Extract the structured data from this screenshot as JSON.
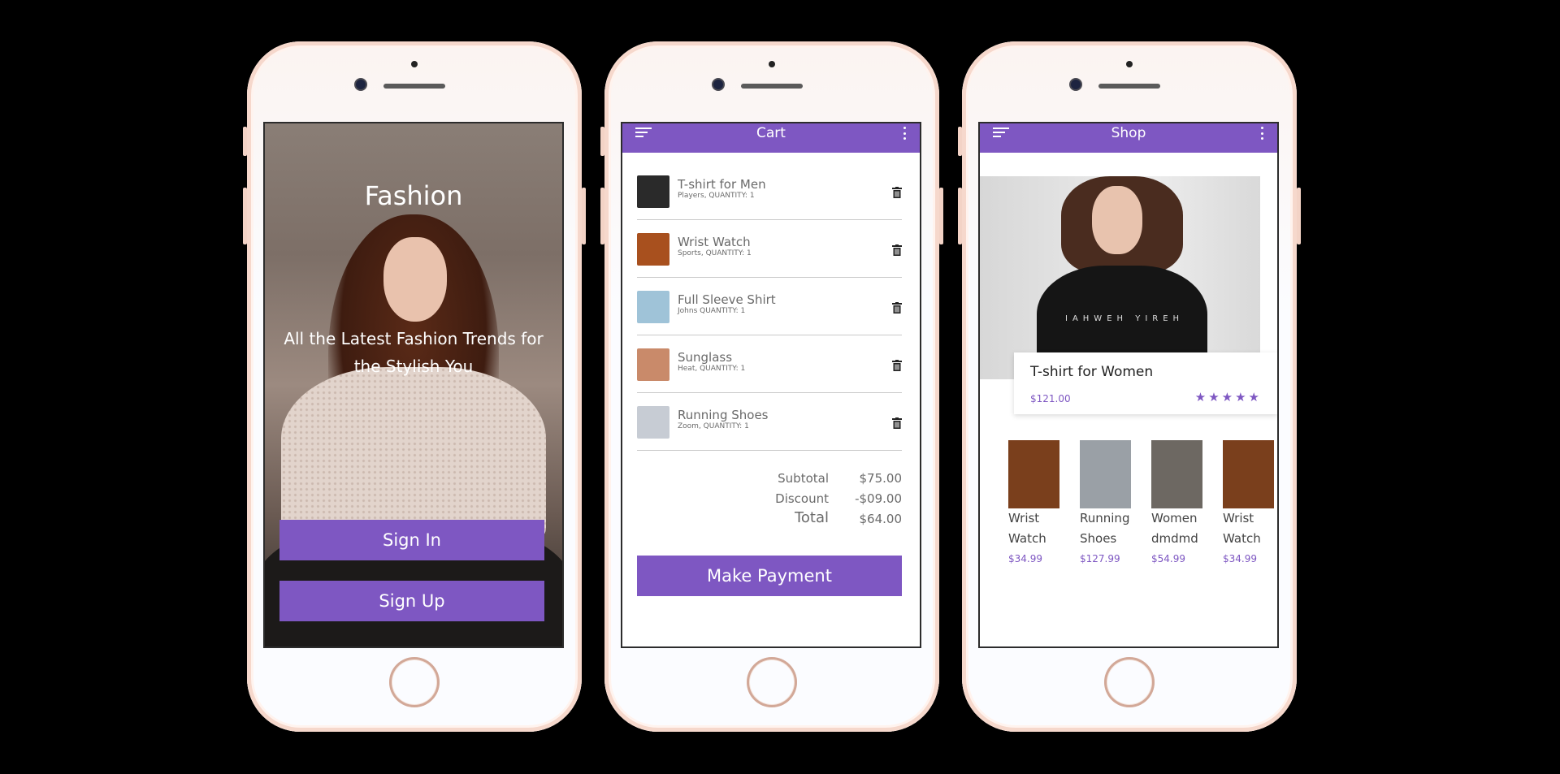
{
  "welcome": {
    "title": "Fashion",
    "subtitle": "All the Latest Fashion Trends for the Stylish You",
    "sign_in": "Sign In",
    "sign_up": "Sign Up"
  },
  "cart": {
    "title": "Cart",
    "items": [
      {
        "name": "T-shirt for Men",
        "meta": "Players, QUANTITY: 1",
        "thumb_color": "#2a2a2a"
      },
      {
        "name": "Wrist Watch",
        "meta": "Sports, QUANTITY: 1",
        "thumb_color": "#a8501e"
      },
      {
        "name": "Full Sleeve Shirt",
        "meta": "Johns QUANTITY: 1",
        "thumb_color": "#9fc3d8"
      },
      {
        "name": "Sunglass",
        "meta": "Heat, QUANTITY: 1",
        "thumb_color": "#c98a6a"
      },
      {
        "name": "Running Shoes",
        "meta": "Zoom, QUANTITY: 1",
        "thumb_color": "#c7ccd4"
      }
    ],
    "subtotal_label": "Subtotal",
    "subtotal_value": "$75.00",
    "discount_label": "Discount",
    "discount_value": "-$09.00",
    "total_label": "Total",
    "total_value": "$64.00",
    "pay_button": "Make Payment"
  },
  "shop": {
    "title": "Shop",
    "hero_shirt_text": "IAHWEH YIREH",
    "featured": {
      "name": "T-shirt for Women",
      "price": "$121.00",
      "rating": 5
    },
    "products": [
      {
        "name": "Wrist Watch",
        "price": "$34.99",
        "thumb_color": "#7a3f1c"
      },
      {
        "name": "Running Shoes",
        "price": "$127.99",
        "thumb_color": "#9aa0a6"
      },
      {
        "name": "Women dmdmd",
        "price": "$54.99",
        "thumb_color": "#6d6862"
      },
      {
        "name": "Wrist Watch",
        "price": "$34.99",
        "thumb_color": "#7a3f1c"
      }
    ]
  },
  "colors": {
    "accent": "#7e57c2"
  }
}
